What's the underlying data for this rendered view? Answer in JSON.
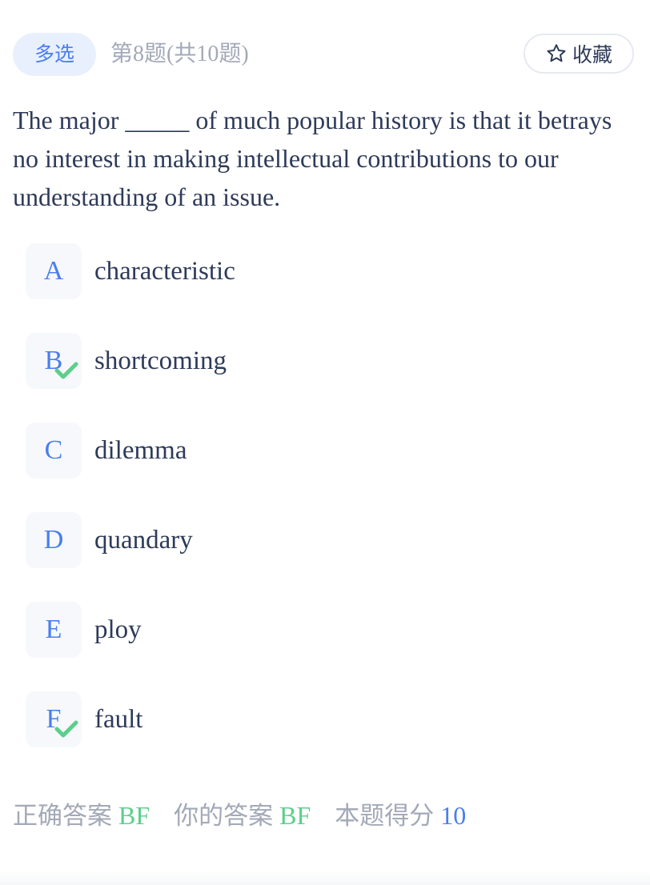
{
  "header": {
    "type_badge": "多选",
    "question_index": "第8题(共10题)",
    "favorite_label": "收藏",
    "favorite_icon": "star-outline-icon"
  },
  "question": {
    "stem": "The major _____ of much popular history is that it betrays no interest in making intellectual contributions to our understanding of an issue."
  },
  "options": [
    {
      "letter": "A",
      "text": "characteristic",
      "correct": false
    },
    {
      "letter": "B",
      "text": "shortcoming",
      "correct": true
    },
    {
      "letter": "C",
      "text": "dilemma",
      "correct": false
    },
    {
      "letter": "D",
      "text": "quandary",
      "correct": false
    },
    {
      "letter": "E",
      "text": "ploy",
      "correct": false
    },
    {
      "letter": "F",
      "text": "fault",
      "correct": true
    }
  ],
  "result": {
    "correct_label": "正确答案",
    "correct_answer": "BF",
    "your_label": "你的答案",
    "your_answer": "BF",
    "score_label": "本题得分",
    "score": "10"
  },
  "colors": {
    "accent": "#4a7ef0",
    "correct": "#5bcf8b",
    "muted": "#a3a9b8",
    "text": "#2e3a59"
  }
}
